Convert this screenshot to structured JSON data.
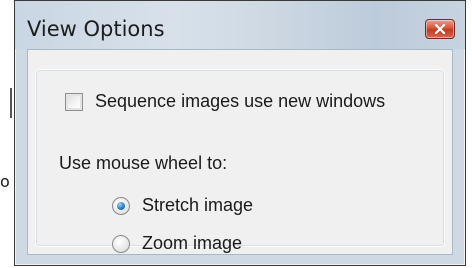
{
  "background_fragment": {
    "text": "o"
  },
  "window": {
    "title": "View Options",
    "close_icon": "close-icon",
    "accent_color": "#d8553c"
  },
  "options": {
    "sequence_checkbox": {
      "label": "Sequence images use new windows",
      "checked": false
    },
    "mouse_wheel_label": "Use mouse wheel to:",
    "mouse_wheel_options": [
      {
        "label": "Stretch image",
        "selected": true
      },
      {
        "label": "Zoom image",
        "selected": false
      }
    ]
  }
}
